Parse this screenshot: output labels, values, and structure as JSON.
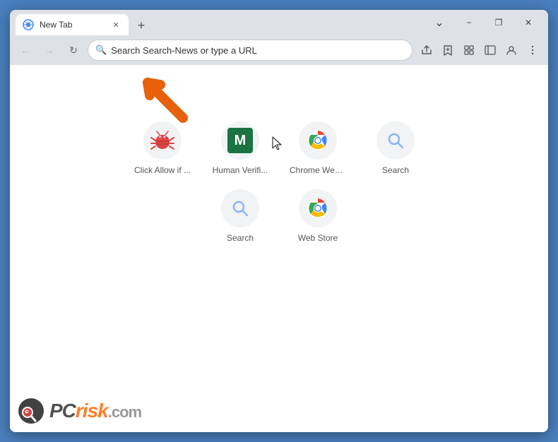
{
  "window": {
    "title": "New Tab",
    "minimize_label": "−",
    "restore_label": "❐",
    "close_label": "✕",
    "new_tab_label": "+"
  },
  "toolbar": {
    "back_label": "←",
    "forward_label": "→",
    "reload_label": "↻",
    "address_placeholder": "Search Search-News or type a URL",
    "address_value": "Search Search-News or type a URL",
    "share_label": "⎋",
    "bookmark_label": "☆",
    "extension_label": "🧩",
    "sidebar_label": "▤",
    "profile_label": "👤",
    "menu_label": "⋮"
  },
  "shortcuts": {
    "row1": [
      {
        "id": "click-allow",
        "label": "Click Allow if ...",
        "type": "bug"
      },
      {
        "id": "human-verif",
        "label": "Human Verifi...",
        "type": "m"
      },
      {
        "id": "chrome-web",
        "label": "Chrome Web ...",
        "type": "chrome"
      },
      {
        "id": "search1",
        "label": "Search",
        "type": "search-blue"
      }
    ],
    "row2": [
      {
        "id": "search2",
        "label": "Search",
        "type": "search-blue"
      },
      {
        "id": "web-store",
        "label": "Web Store",
        "type": "chrome"
      }
    ]
  },
  "watermark": {
    "pc": "PC",
    "risk": "risk",
    "com": ".com"
  }
}
